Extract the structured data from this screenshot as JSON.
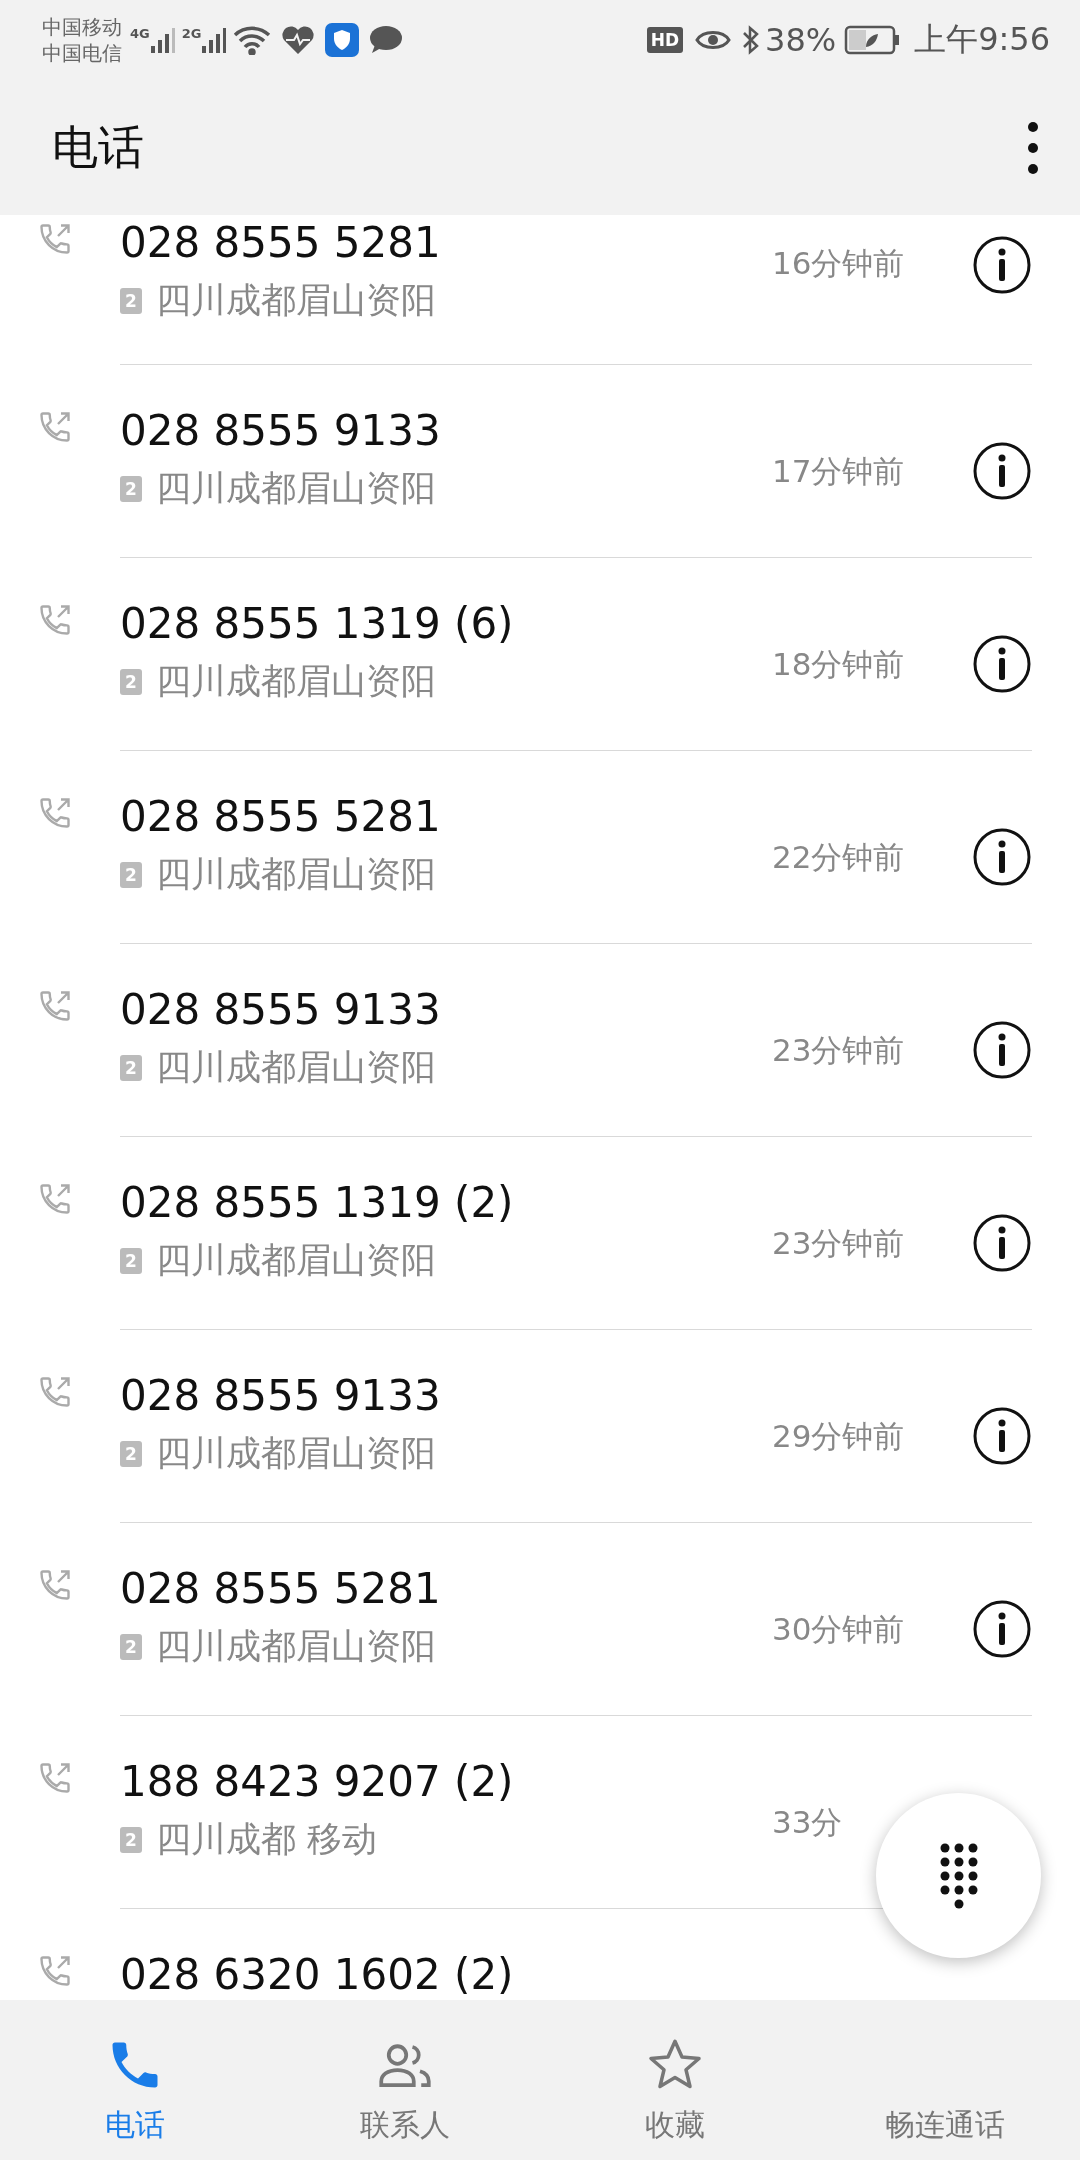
{
  "status_bar": {
    "carriers": [
      "中国移动",
      "中国电信"
    ],
    "network_1": "4G",
    "network_2": "2G",
    "hd": "HD",
    "battery": "38%",
    "time": "上午9:56"
  },
  "header": {
    "title": "电话"
  },
  "calls": [
    {
      "number": "028 8555 5281",
      "sim": "2",
      "location": "四川成都眉山资阳",
      "time": "16分钟前",
      "info_button": true
    },
    {
      "number": "028 8555 9133",
      "sim": "2",
      "location": "四川成都眉山资阳",
      "time": "17分钟前",
      "info_button": true
    },
    {
      "number": "028 8555 1319 (6)",
      "sim": "2",
      "location": "四川成都眉山资阳",
      "time": "18分钟前",
      "info_button": true
    },
    {
      "number": "028 8555 5281",
      "sim": "2",
      "location": "四川成都眉山资阳",
      "time": "22分钟前",
      "info_button": true
    },
    {
      "number": "028 8555 9133",
      "sim": "2",
      "location": "四川成都眉山资阳",
      "time": "23分钟前",
      "info_button": true
    },
    {
      "number": "028 8555 1319 (2)",
      "sim": "2",
      "location": "四川成都眉山资阳",
      "time": "23分钟前",
      "info_button": true
    },
    {
      "number": "028 8555 9133",
      "sim": "2",
      "location": "四川成都眉山资阳",
      "time": "29分钟前",
      "info_button": true
    },
    {
      "number": "028 8555 5281",
      "sim": "2",
      "location": "四川成都眉山资阳",
      "time": "30分钟前",
      "info_button": true
    },
    {
      "number": "188 8423 9207 (2)",
      "sim": "2",
      "location": "四川成都 移动",
      "time": "33分",
      "info_button": false
    },
    {
      "number": "028 6320 1602 (2)",
      "info_button": false
    }
  ],
  "tabs": [
    {
      "label": "电话",
      "kind": "phone",
      "selected": true
    },
    {
      "label": "联系人",
      "kind": "contacts",
      "selected": false
    },
    {
      "label": "收藏",
      "kind": "favorites",
      "selected": false
    },
    {
      "label": "畅连通话",
      "kind": "hidden",
      "selected": false
    }
  ]
}
